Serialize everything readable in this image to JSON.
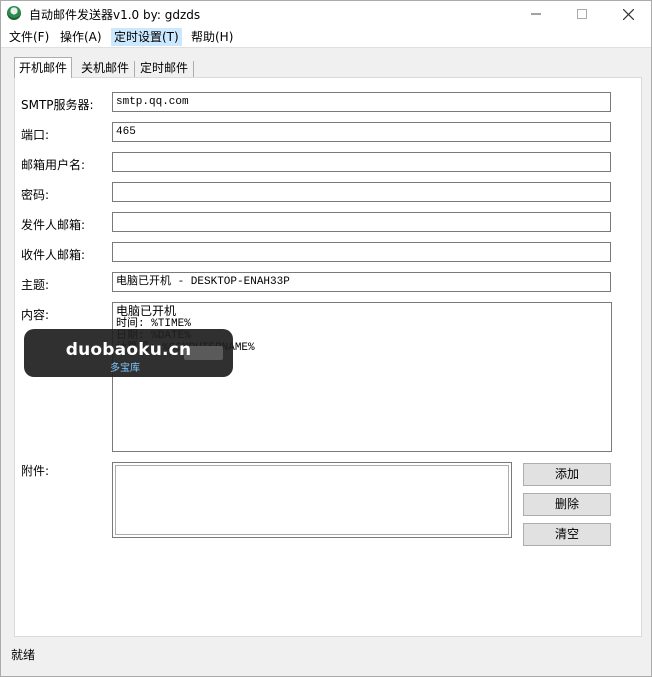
{
  "window": {
    "title": "自动邮件发送器v1.0  by: gdzds"
  },
  "menu": [
    {
      "label": "文件(F)",
      "active": false
    },
    {
      "label": "操作(A)",
      "active": false
    },
    {
      "label": "定时设置(T)",
      "active": true
    },
    {
      "label": "帮助(H)",
      "active": false
    }
  ],
  "tabs": [
    {
      "label": "开机邮件",
      "selected": true
    },
    {
      "label": "关机邮件",
      "selected": false
    },
    {
      "label": "定时邮件",
      "selected": false
    }
  ],
  "form": {
    "smtp_label": "SMTP服务器:",
    "smtp_value": "smtp.qq.com",
    "port_label": "端口:",
    "port_value": "465",
    "username_label": "邮箱用户名:",
    "username_value": "",
    "password_label": "密码:",
    "password_value": "",
    "sender_label": "发件人邮箱:",
    "sender_value": "",
    "recipient_label": "收件人邮箱:",
    "recipient_value": "",
    "subject_label": "主题:",
    "subject_value": "电脑已开机 - DESKTOP-ENAH33P",
    "content_label": "内容:",
    "content_lines": [
      "电脑已开机",
      "时间: %TIME%",
      "日期: %DATE%",
      "计算机: %COMPUTERNAME%"
    ],
    "attachment_label": "附件:"
  },
  "buttons": {
    "add": "添加",
    "delete": "删除",
    "clear": "清空"
  },
  "status": {
    "text": "就绪"
  },
  "watermark": {
    "main": "duobaoku.cn",
    "sub": "多宝库"
  }
}
